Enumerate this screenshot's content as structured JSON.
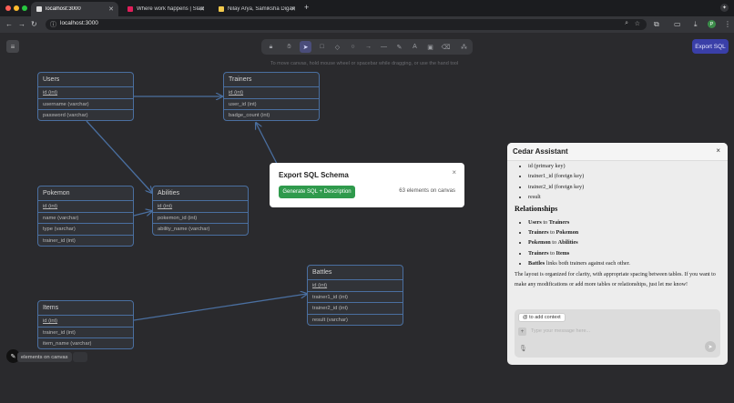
{
  "browser": {
    "tabs": [
      {
        "title": "localhost:3000",
        "active": true,
        "favicon_color": "#ffffff"
      },
      {
        "title": "Where work happens | Slack",
        "active": false,
        "favicon_color": "#e01e5a"
      },
      {
        "title": "Nilay Arya, Samiksha Digamb",
        "active": false,
        "favicon_color": "#f2c94c"
      }
    ],
    "new_tab": "+",
    "url": "localhost:3000",
    "profile_initial": "P"
  },
  "toolbar": {
    "hint": "To move canvas, hold mouse wheel or spacebar while dragging, or use the hand tool",
    "export_label": "Export SQL"
  },
  "tables": [
    {
      "id": "users",
      "name": "Users",
      "rows": [
        {
          "text": "id (int)",
          "pk": true
        },
        {
          "text": "username (varchar)",
          "pk": false
        },
        {
          "text": "password (varchar)",
          "pk": false
        }
      ]
    },
    {
      "id": "trainers",
      "name": "Trainers",
      "rows": [
        {
          "text": "id (int)",
          "pk": true
        },
        {
          "text": "user_id (int)",
          "pk": false
        },
        {
          "text": "badge_count (int)",
          "pk": false
        }
      ]
    },
    {
      "id": "pokemon",
      "name": "Pokemon",
      "rows": [
        {
          "text": "id (int)",
          "pk": true
        },
        {
          "text": "name (varchar)",
          "pk": false
        },
        {
          "text": "type (varchar)",
          "pk": false
        },
        {
          "text": "trainer_id (int)",
          "pk": false
        }
      ]
    },
    {
      "id": "abilities",
      "name": "Abilities",
      "rows": [
        {
          "text": "id (int)",
          "pk": true
        },
        {
          "text": "pokemon_id (int)",
          "pk": false
        },
        {
          "text": "ability_name (varchar)",
          "pk": false
        }
      ]
    },
    {
      "id": "items",
      "name": "Items",
      "rows": [
        {
          "text": "id (int)",
          "pk": true
        },
        {
          "text": "trainer_id (int)",
          "pk": false
        },
        {
          "text": "item_name (varchar)",
          "pk": false
        }
      ]
    },
    {
      "id": "battles",
      "name": "Battles",
      "rows": [
        {
          "text": "id (int)",
          "pk": true
        },
        {
          "text": "trainer1_id (int)",
          "pk": false
        },
        {
          "text": "trainer2_id (int)",
          "pk": false
        },
        {
          "text": "result (varchar)",
          "pk": false
        }
      ]
    }
  ],
  "modal": {
    "title": "Export SQL Schema",
    "button_label": "Generate SQL + Description",
    "count_text": "63 elements on canvas",
    "close": "×"
  },
  "assistant": {
    "title": "Cedar Assistant",
    "close": "×",
    "columns": [
      "id (primary key)",
      "trainer1_id (foreign key)",
      "trainer2_id (foreign key)",
      "result"
    ],
    "relationships_heading": "Relationships",
    "relationships": [
      {
        "a": "Users",
        "mid": " to ",
        "b": "Trainers",
        "rest": ""
      },
      {
        "a": "Trainers",
        "mid": " to ",
        "b": "Pokemon",
        "rest": ""
      },
      {
        "a": "Pokemon",
        "mid": " to ",
        "b": "Abilities",
        "rest": ""
      },
      {
        "a": "Trainers",
        "mid": " to ",
        "b": "Items",
        "rest": ""
      },
      {
        "a": "Battles",
        "mid": " links both trainers against each other.",
        "b": "",
        "rest": ""
      }
    ],
    "paragraph": "The layout is organized for clarity, with appropriate spacing between tables. If you want to make any modifications or add more tables or relationships, just let me know!",
    "context_button": "@ to add context",
    "input_placeholder": "Type your message here...",
    "plus": "+"
  },
  "status": {
    "elements_label": "elements on canvas"
  },
  "colors": {
    "table_border": "#4a6fa0",
    "edge": "#4a6fa0",
    "accent_button": "#3a3fa8",
    "generate_button": "#2f9a4c"
  }
}
